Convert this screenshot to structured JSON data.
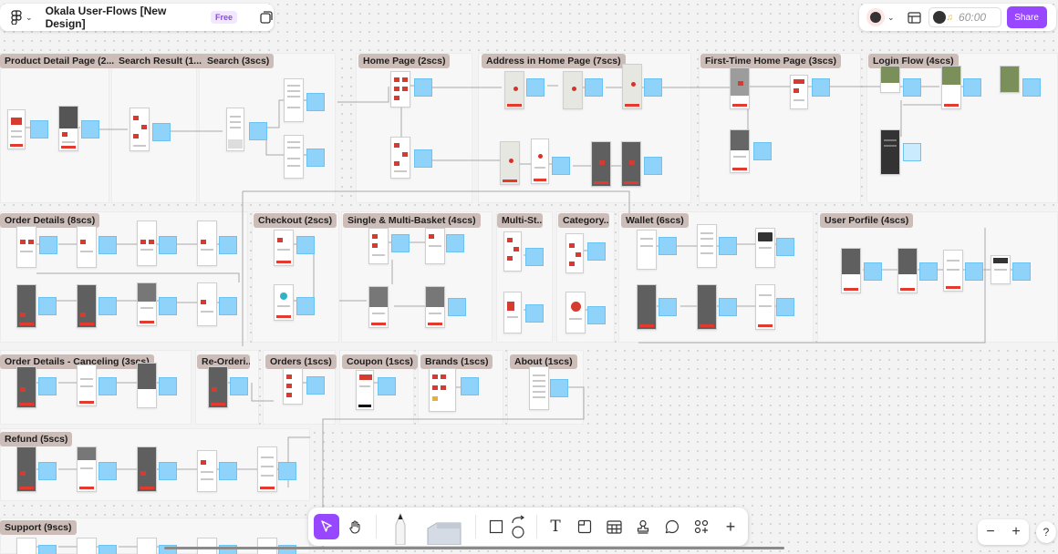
{
  "file": {
    "title": "Okala User-Flows [New Design]",
    "plan_badge": "Free"
  },
  "header_right": {
    "timer": "60:00",
    "share_label": "Share"
  },
  "sections": [
    "Product Detail Page (2...",
    "Search Result (1...",
    "Search (3scs)",
    "Home Page (2scs)",
    "Address in Home Page (7scs)",
    "First-Time Home Page (3scs)",
    "Login Flow (4scs)",
    "Order Details (8scs)",
    "Checkout (2scs)",
    "Single & Multi-Basket (4scs)",
    "Multi-St...",
    "Category...",
    "Wallet (6scs)",
    "User Porfile (4scs)",
    "Order Details - Canceling (3scs)",
    "Re-Orderi...",
    "Orders (1scs)",
    "Coupon (1scs)",
    "Brands (1scs)",
    "About (1scs)",
    "Refund (5scs)",
    "Support (9scs)"
  ],
  "toolbar": {
    "tools": [
      "move-tool",
      "hand-tool",
      "pen-tool",
      "marker-tool",
      "shape-tool",
      "connector-tool",
      "text-tool",
      "section-tool",
      "table-tool",
      "stamp-tool",
      "comment-tool",
      "widgets-tool",
      "more-tool"
    ]
  },
  "zoom": {
    "minus": "−",
    "plus": "+"
  },
  "help_label": "?",
  "colors": {
    "accent": "#9747ff",
    "note": "#8fd3fb",
    "section_label": "#cdbdb8",
    "brand_red": "#d63b2f"
  }
}
